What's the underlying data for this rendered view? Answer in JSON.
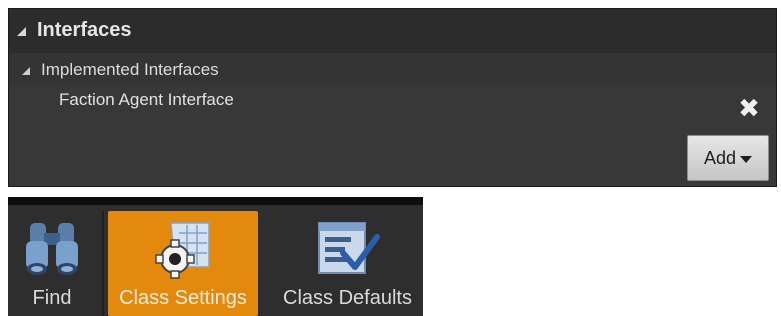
{
  "interfaces_panel": {
    "title": "Interfaces",
    "section_label": "Implemented Interfaces",
    "items": [
      {
        "label": "Faction Agent Interface",
        "remove_icon": "close-icon"
      }
    ],
    "add_button_label": "Add"
  },
  "toolbar": {
    "buttons": [
      {
        "label": "Find",
        "icon": "binoculars-icon"
      },
      {
        "label": "Class Settings",
        "icon": "gear-document-icon",
        "active": true
      },
      {
        "label": "Class Defaults",
        "icon": "checklist-icon"
      }
    ]
  },
  "colors": {
    "panel_bg": "#383838",
    "header_bg": "#2c2c2c",
    "active_button": "#e38a0e",
    "toolbar_bg": "#2e2e2e"
  }
}
